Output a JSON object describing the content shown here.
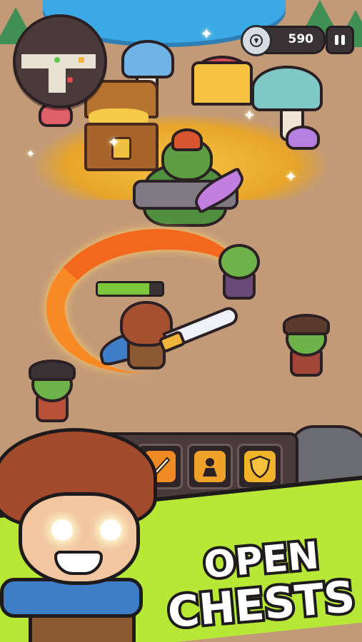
{
  "hud": {
    "coins": "590",
    "icons": {
      "minimap": "minimap",
      "coin": "silver-coin-icon",
      "pause": "pause-icon",
      "skull": "skull-icon"
    }
  },
  "health": {
    "fraction": 0.8
  },
  "abilities": [
    {
      "icon": "dash-skill-icon",
      "color": "#e6862a"
    },
    {
      "icon": "fire-sword-skill-icon",
      "color": "#f08b24"
    },
    {
      "icon": "rage-skill-icon",
      "color": "#f0a12a"
    },
    {
      "icon": "shield-skill-icon",
      "color": "#f0b32a"
    }
  ],
  "promo": {
    "line1": "OPEN",
    "line2": "CHESTS"
  },
  "colors": {
    "ground": "#c29a78",
    "promo_band": "#b6e835",
    "health_fill": "#7cc73b",
    "gold": "#f4c23e"
  }
}
